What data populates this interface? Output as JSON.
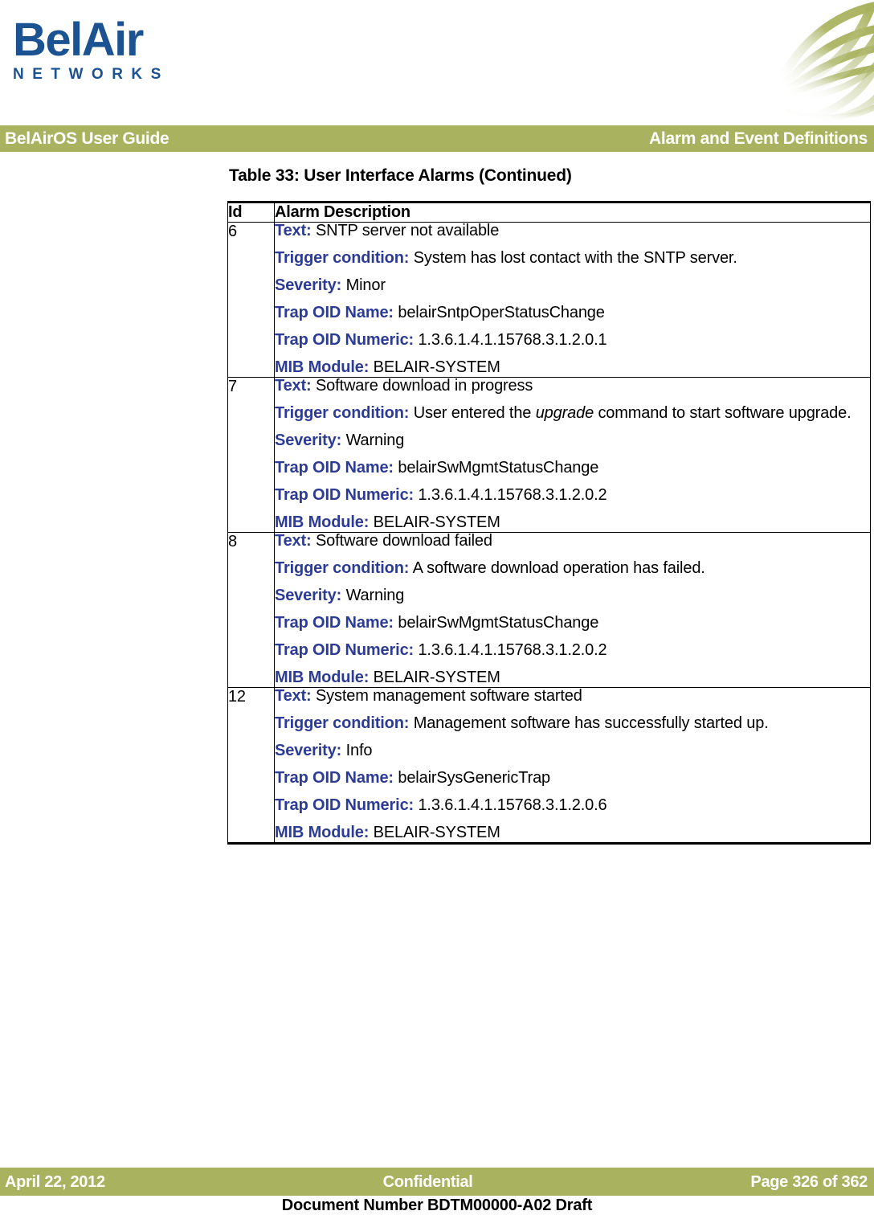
{
  "branding": {
    "logo_wordmark": "BelAir",
    "logo_subtext": "NETWORKS",
    "logo_color": "#1b5392",
    "accent_color": "#a9b35f",
    "label_color": "#2c3b95"
  },
  "header": {
    "left_title": "BelAirOS User Guide",
    "right_title": "Alarm and Event Definitions"
  },
  "table": {
    "caption": "Table 33: User Interface Alarms  (Continued)",
    "columns": [
      "Id",
      "Alarm Description"
    ],
    "rows": [
      {
        "id": "6",
        "fields": [
          {
            "label": "Text:",
            "value": " SNTP server not available"
          },
          {
            "label": "Trigger condition:",
            "value": " System has lost contact with the SNTP server."
          },
          {
            "label": "Severity:",
            "value": " Minor"
          },
          {
            "label": "Trap OID Name:",
            "value": " belairSntpOperStatusChange"
          },
          {
            "label": "Trap OID Numeric:",
            "value": " 1.3.6.1.4.1.15768.3.1.2.0.1"
          },
          {
            "label": "MIB Module:",
            "value": " BELAIR-SYSTEM"
          }
        ]
      },
      {
        "id": "7",
        "fields": [
          {
            "label": "Text:",
            "value": " Software download in progress"
          },
          {
            "label": "Trigger condition:",
            "value": " User entered the ",
            "italic": "upgrade",
            "value_after": " command to start software upgrade."
          },
          {
            "label": "Severity:",
            "value": " Warning"
          },
          {
            "label": "Trap OID Name:",
            "value": " belairSwMgmtStatusChange"
          },
          {
            "label": "Trap OID Numeric:",
            "value": " 1.3.6.1.4.1.15768.3.1.2.0.2"
          },
          {
            "label": "MIB Module:",
            "value": " BELAIR-SYSTEM"
          }
        ]
      },
      {
        "id": "8",
        "fields": [
          {
            "label": "Text:",
            "value": " Software download failed"
          },
          {
            "label": "Trigger condition:",
            "value": " A software download operation has failed."
          },
          {
            "label": "Severity:",
            "value": " Warning"
          },
          {
            "label": "Trap OID Name:",
            "value": " belairSwMgmtStatusChange"
          },
          {
            "label": "Trap OID Numeric:",
            "value": " 1.3.6.1.4.1.15768.3.1.2.0.2"
          },
          {
            "label": "MIB Module:",
            "value": " BELAIR-SYSTEM"
          }
        ]
      },
      {
        "id": "12",
        "fields": [
          {
            "label": "Text:",
            "value": " System management software started"
          },
          {
            "label": "Trigger condition:",
            "value": " Management software has successfully started up."
          },
          {
            "label": "Severity:",
            "value": " Info"
          },
          {
            "label": "Trap OID Name:",
            "value": " belairSysGenericTrap"
          },
          {
            "label": "Trap OID Numeric:",
            "value": " 1.3.6.1.4.1.15768.3.1.2.0.6"
          },
          {
            "label": "MIB Module:",
            "value": " BELAIR-SYSTEM"
          }
        ]
      }
    ]
  },
  "footer": {
    "date": "April 22, 2012",
    "classification": "Confidential",
    "page": "Page 326 of 362",
    "document_number": "Document Number BDTM00000-A02 Draft"
  }
}
